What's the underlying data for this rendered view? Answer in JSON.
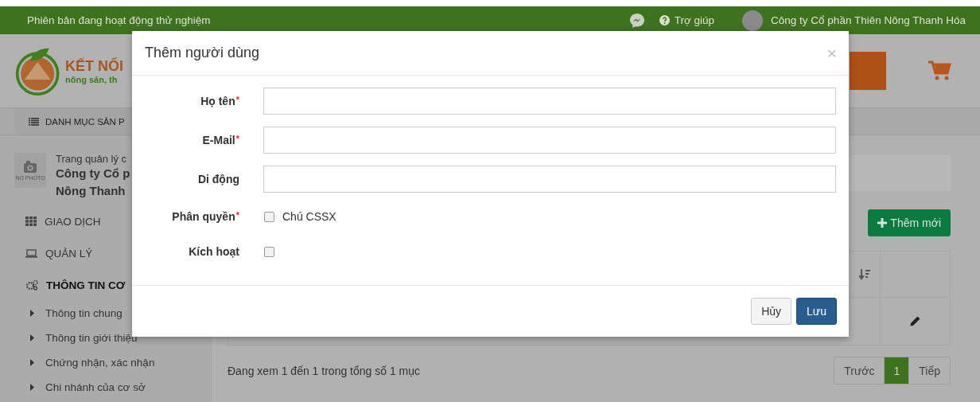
{
  "top_bar": {
    "notice": "Phiên bản đang hoạt động thử nghiệm",
    "help": "Trợ giúp",
    "company": "Công ty Cổ phần Thiên Nông Thanh Hóa"
  },
  "header": {
    "logo_title": "KẾT NỐI",
    "logo_subtitle": "nông sản, th"
  },
  "nav": {
    "category_menu": "DANH MỤC SẢN P"
  },
  "sidebar": {
    "photo_label": "NO PHOTO",
    "page_caption": "Trang quản lý c",
    "company_lines": [
      "Công ty Cổ p",
      "Nông Thanh"
    ],
    "menu": [
      {
        "label": "GIAO DỊCH",
        "kind": "grid",
        "expanded": false
      },
      {
        "label": "QUẢN LÝ",
        "kind": "laptop",
        "expanded": false
      },
      {
        "label": "THÔNG TIN CƠ",
        "kind": "gears",
        "expanded": true,
        "children": [
          {
            "label": "Thông tin chung"
          },
          {
            "label": "Thông tin giới thiệu"
          },
          {
            "label": "Chứng nhận, xác nhận"
          },
          {
            "label": "Chi nhánh của cơ sở"
          }
        ]
      }
    ]
  },
  "content": {
    "add_button": "Thêm mới",
    "summary": "Đang xem 1 đến 1 trong tổng số 1 mục",
    "pagination": [
      {
        "label": "Trước",
        "selected": false
      },
      {
        "label": "1",
        "selected": true
      },
      {
        "label": "Tiếp",
        "selected": false
      }
    ]
  },
  "dialog": {
    "title": "Thêm người dùng",
    "close": "×",
    "fields": [
      {
        "label": "Họ tên",
        "required_mark": "*",
        "kind": "text"
      },
      {
        "label": "E-Mail",
        "required_mark": "*",
        "kind": "text"
      },
      {
        "label": "Di động",
        "kind": "text"
      },
      {
        "label": "Phân quyền",
        "required_mark": "*",
        "kind": "options",
        "options": [
          {
            "label": "Chú CSSX",
            "checked": false
          }
        ]
      },
      {
        "label": "Kích hoạt",
        "kind": "checkbox",
        "checked": false
      }
    ],
    "buttons": [
      {
        "label": "Hủy",
        "kind": "secondary"
      },
      {
        "label": "Lưu",
        "kind": "primary"
      }
    ]
  }
}
